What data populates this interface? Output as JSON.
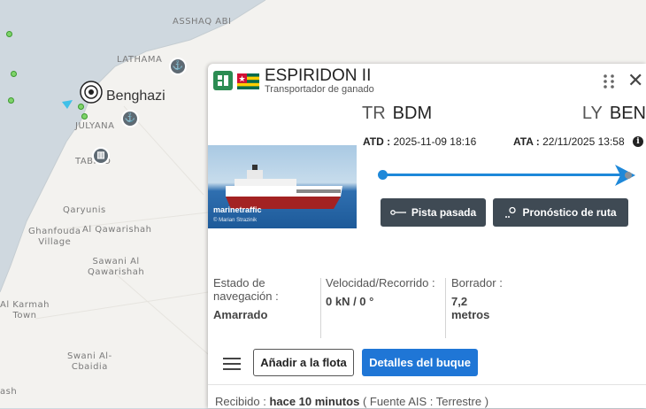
{
  "map": {
    "places": {
      "asshaq_abi": "ASSHAQ ABI",
      "lathama": "LATHAMA",
      "benghazi": "Benghazi",
      "julyana": "JULYANA",
      "tabino": "TABINO",
      "qaryunis": "Qaryunis",
      "ghanfouda_1": "Ghanfouda",
      "ghanfouda_2": "Village",
      "al_qawarishah": "Al Qawarishah",
      "sawani_1": "Sawani Al",
      "sawani_2": "Qawarishah",
      "alkarmah_1": "Al Karmah",
      "alkarmah_2": "Town",
      "swani_1": "Swani Al-",
      "swani_2": "Cbaidia",
      "ash": "ash"
    },
    "icons": [
      "port-icon",
      "port-icon",
      "museum-icon",
      "selected-vessel-icon"
    ],
    "colors": {
      "land": "#f3f2ef",
      "sea": "#cfd8df",
      "vessel": "#7ed36a"
    }
  },
  "vessel": {
    "name": "ESPIRIDON II",
    "type": "Transportador de ganado",
    "flag": "Togo",
    "photo_brand": "marinetraffic",
    "photo_credit": "© Marian Strazinik"
  },
  "route": {
    "from_country": "TR",
    "from_port": "BDM",
    "to_country": "LY",
    "to_port": "BEN",
    "atd_label": "ATD :",
    "atd_value": "2025-11-09 18:16",
    "ata_label": "ATA :",
    "ata_value": "22/11/2025 13:58",
    "progress": 1.0,
    "past_track_button": "Pista pasada",
    "forecast_button": "Pronóstico de ruta"
  },
  "info": {
    "nav_status_label": "Estado de navegación :",
    "nav_status_value": "Amarrado",
    "speed_label": "Velocidad/Recorrido :",
    "speed_value": "0 kN / 0 °",
    "draught_label": "Borrador :",
    "draught_value": "7,2 metros"
  },
  "actions": {
    "add_fleet": "Añadir a la flota",
    "details": "Detalles del buque"
  },
  "footer": {
    "received_label": "Recibido :",
    "received_value": "hace 10 minutos",
    "source": "( Fuente AIS : Terrestre )"
  },
  "colors": {
    "primary": "#1f76d6",
    "dark_button": "#3f4a54",
    "track": "#1e88d9",
    "vessel_type": "#2c8c52"
  }
}
